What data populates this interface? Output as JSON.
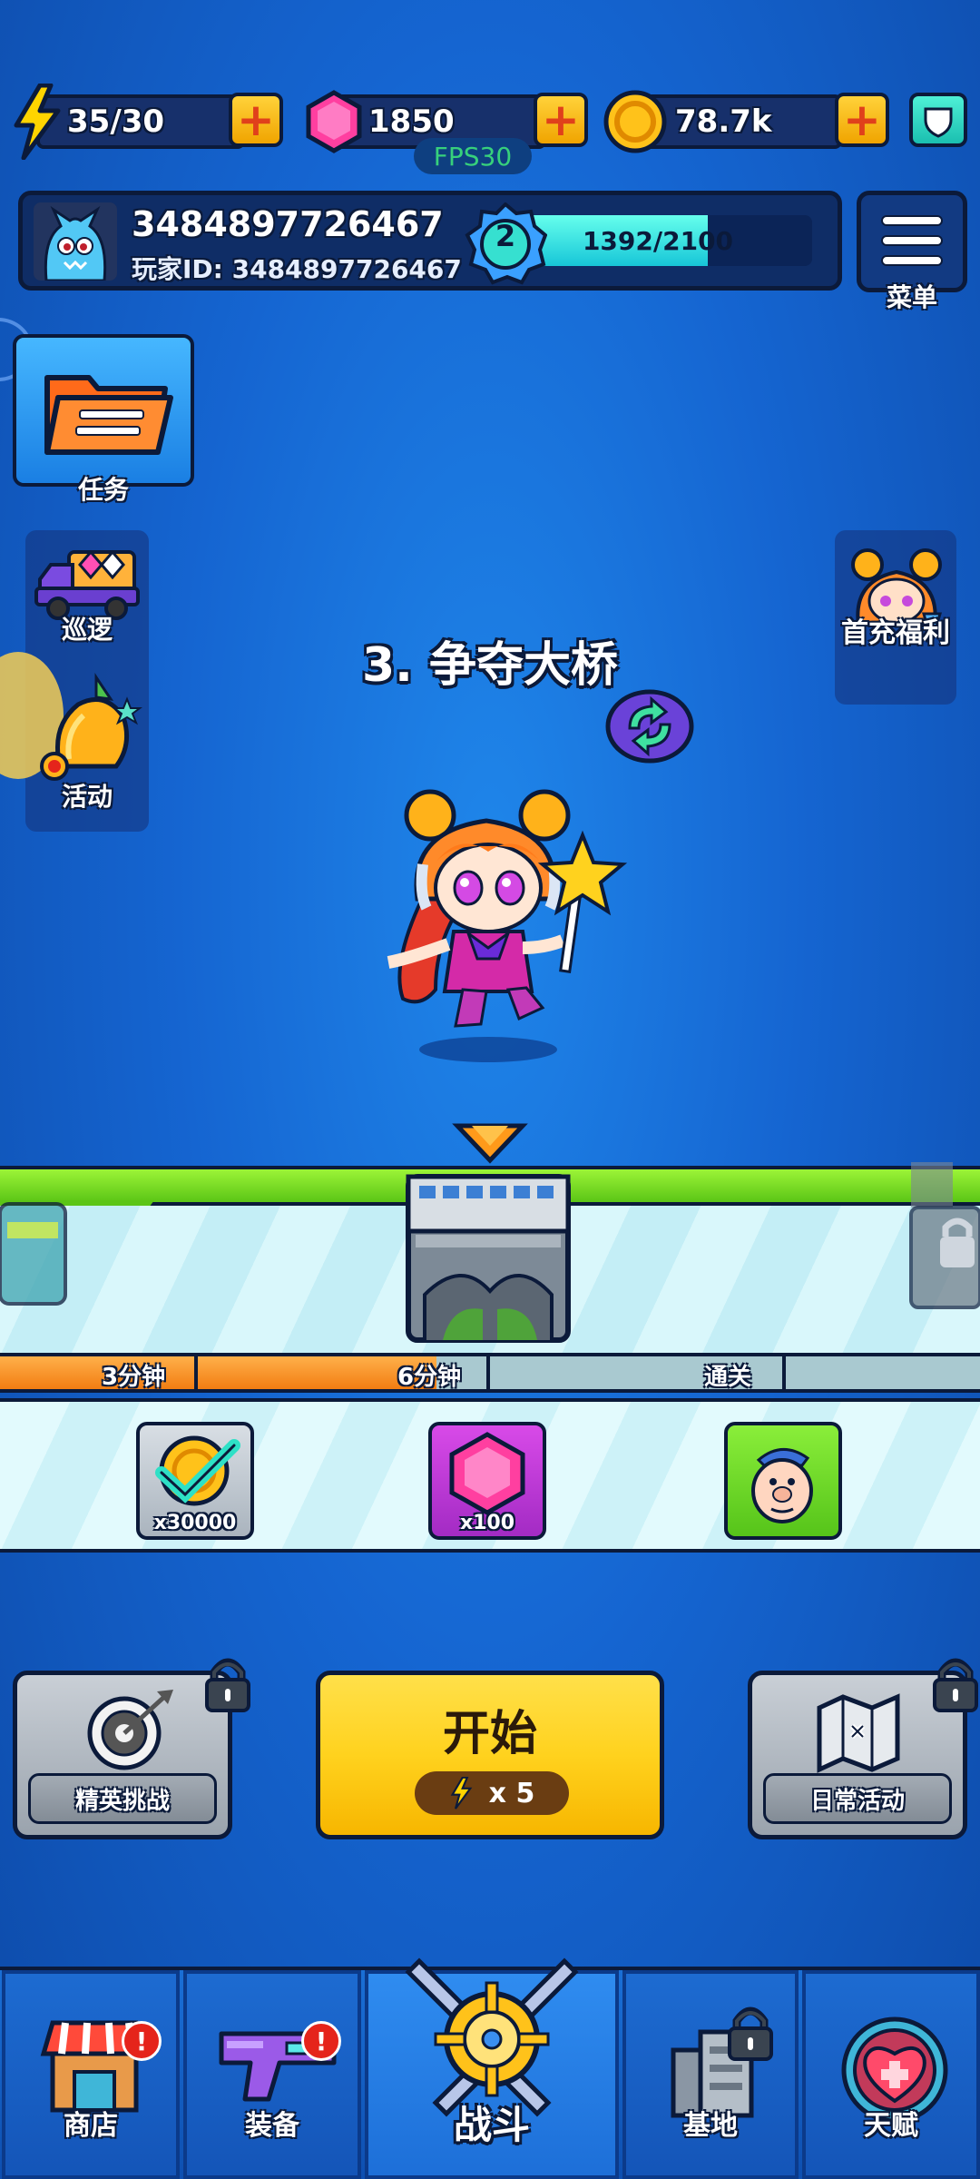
{
  "resources": {
    "energy": "35/30",
    "gems": "1850",
    "coins": "78.7k"
  },
  "fps": "FPS30",
  "player": {
    "name": "3484897726467",
    "id_text": "玩家ID: 3484897726467",
    "level": "2",
    "xp_text": "1392/2100",
    "xp_fraction": 0.663
  },
  "menu_label": "菜单",
  "side": {
    "task": "任务",
    "patrol": "巡逻",
    "event": "活动",
    "first_recharge": "首充福利"
  },
  "stage": {
    "title": "3. 争夺大桥"
  },
  "progress": {
    "fill_fraction": 0.445,
    "milestones": [
      "3分钟",
      "6分钟",
      "通关"
    ]
  },
  "rewards": [
    {
      "icon": "coin-check-icon",
      "qty": "x30000"
    },
    {
      "icon": "gem-icon",
      "qty": "x100"
    },
    {
      "icon": "character-face-icon",
      "qty": ""
    }
  ],
  "actions": {
    "elite": "精英挑战",
    "start": "开始",
    "start_cost": "x 5",
    "daily": "日常活动"
  },
  "nav": {
    "shop": "商店",
    "equip": "装备",
    "battle": "战斗",
    "base": "基地",
    "talent": "天赋",
    "badge": "!"
  },
  "colors": {
    "background": "#1565d1",
    "start_button": "#ffd21e",
    "xp_fill": "#17c6d8",
    "progress_fill": "#f27d12"
  }
}
